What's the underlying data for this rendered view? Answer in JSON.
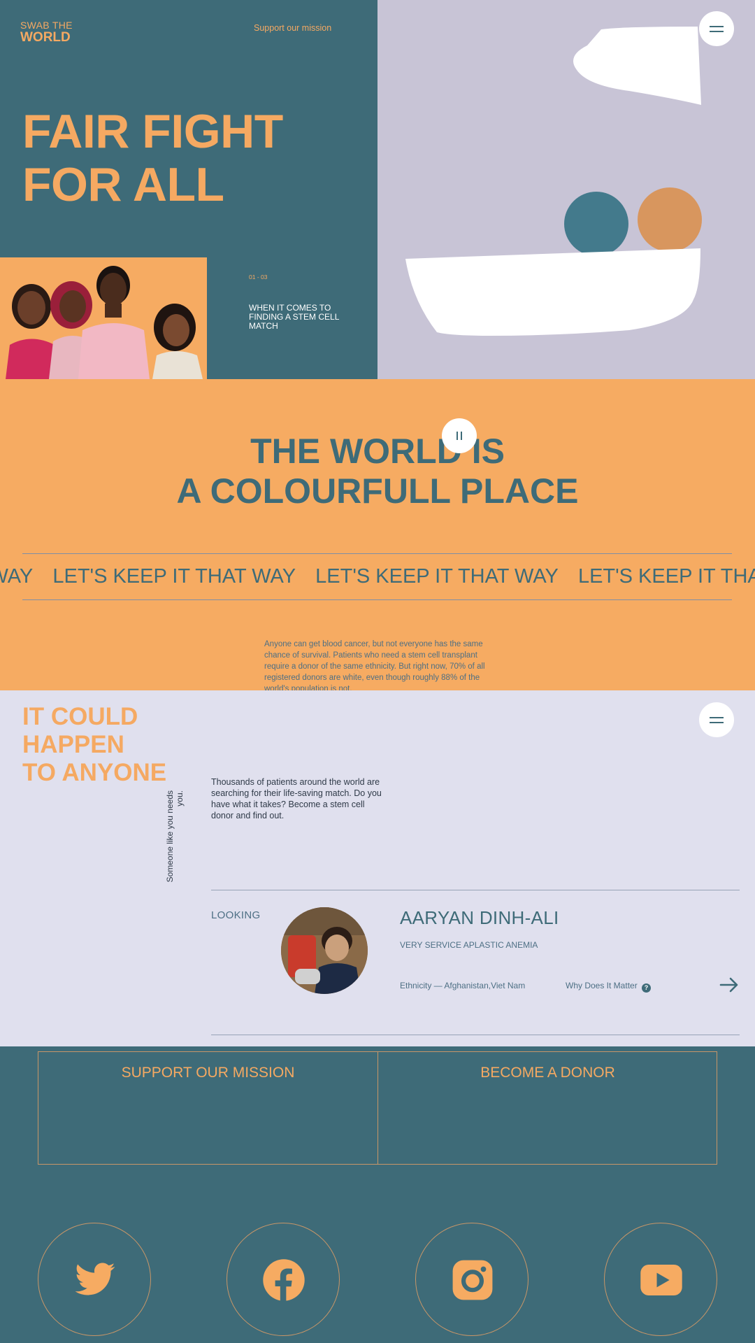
{
  "colors": {
    "teal": "#3e6b78",
    "orange": "#f6ab62",
    "lavender": "#c8c4d6",
    "light_lavender": "#e0e0ee",
    "white": "#ffffff"
  },
  "header": {
    "logo_line1": "SWAB THE",
    "logo_line2": "WORLD",
    "support_link": "Support our mission",
    "menu_icon": "hamburger-menu-icon"
  },
  "hero": {
    "title_line1": "FAIR FIGHT",
    "title_line2": "FOR ALL",
    "slide_counter": "01 - 03",
    "slide_text": "WHEN IT COMES TO FINDING A STEM CELL MATCH"
  },
  "colourful": {
    "pause_icon": "pause-icon",
    "title_line1": "THE WORLD IS",
    "title_line2": "A COLOURFULL PLACE",
    "marquee": [
      "AT WAY",
      "LET'S KEEP IT THAT WAY",
      "LET'S KEEP IT THAT WAY",
      "LET'S KEEP IT THAT"
    ],
    "body": "Anyone can get blood cancer, but not everyone has the same chance of survival. Patients who need a stem cell transplant require a donor of the same ethnicity. But right now, 70% of all registered donors are white, even though roughly 88% of the world's population is not."
  },
  "anyone": {
    "title_line1": "IT COULD",
    "title_line2": "HAPPEN",
    "title_line3": "TO ANYONE",
    "vertical_text": "Someone like you needs you.",
    "copy": "Thousands of patients around the world are searching for their life-saving match. Do you have what it takes? Become a stem cell donor and find out.",
    "looking_label": "LOOKING",
    "patient": {
      "name": "AARYAN DINH-ALI",
      "condition": "VERY SERVICE APLASTIC ANEMIA",
      "ethnicity": "Ethnicity — Afghanistan,Viet Nam",
      "why_label": "Why Does It Matter",
      "why_icon": "?"
    }
  },
  "footer": {
    "cta_left": "SUPPORT OUR MISSION",
    "cta_right": "BECOME A DONOR",
    "social": [
      "twitter-icon",
      "facebook-icon",
      "instagram-icon",
      "youtube-icon"
    ]
  }
}
